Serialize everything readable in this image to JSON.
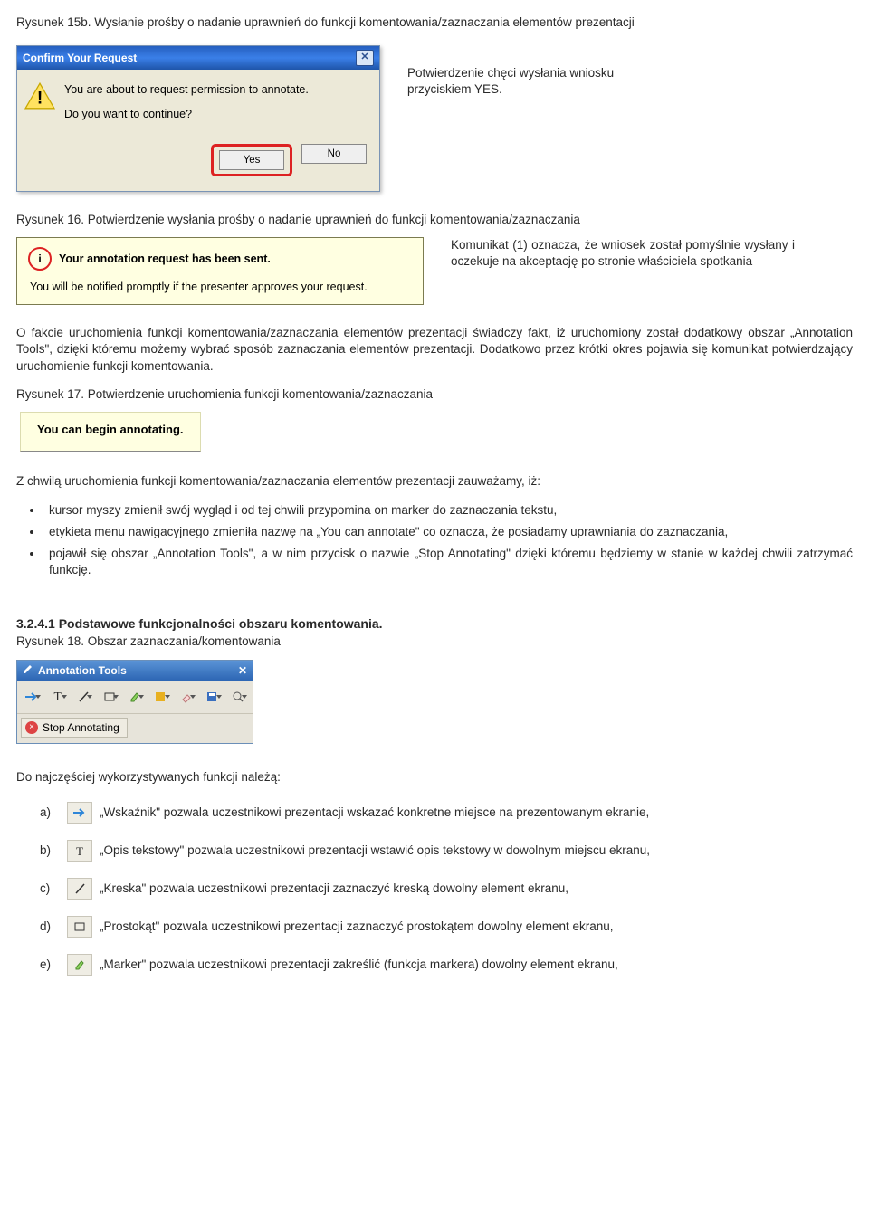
{
  "caption15b": "Rysunek 15b. Wysłanie prośby o nadanie uprawnień do funkcji komentowania/zaznaczania elementów prezentacji",
  "dlg1": {
    "title": "Confirm Your Request",
    "line1": "You are about to request permission to annotate.",
    "line2": "Do you want to continue?",
    "yes": "Yes",
    "no": "No",
    "close": "✕"
  },
  "aside1_l1": "Potwierdzenie chęci wysłania wniosku",
  "aside1_l2": "przyciskiem YES.",
  "caption16": "Rysunek 16. Potwierdzenie wysłania prośby o nadanie uprawnień do funkcji komentowania/zaznaczania",
  "info": {
    "badge": "i",
    "hdr": "Your annotation request has been sent.",
    "sub": "You will be notified promptly if the presenter approves your request."
  },
  "aside2": "Komunikat (1) oznacza, że wniosek został pomyślnie wysłany i oczekuje na akceptację po stronie właściciela spotkania",
  "para_fact": "O fakcie uruchomienia funkcji komentowania/zaznaczania elementów prezentacji świadczy fakt, iż uruchomiony został dodatkowy obszar „Annotation Tools\", dzięki któremu możemy wybrać sposób zaznaczania elementów  prezentacji. Dodatkowo przez krótki okres pojawia się komunikat potwierdzający uruchomienie funkcji komentowania.",
  "caption17": "Rysunek 17. Potwierdzenie uruchomienia funkcji komentowania/zaznaczania",
  "begin": "You can begin annotating.",
  "para_zchwil": "Z chwilą uruchomienia funkcji komentowania/zaznaczania elementów prezentacji zauważamy, iż:",
  "bul1": "kursor myszy zmienił swój wygląd i  od tej chwili przypomina on marker do zaznaczania tekstu,",
  "bul2": "etykieta menu nawigacyjnego zmieniła nazwę na „You can annotate\" co oznacza, że posiadamy uprawniania do zaznaczania,",
  "bul3": "pojawił się obszar „Annotation Tools\", a w nim przycisk o nazwie „Stop Annotating\" dzięki któremu będziemy w stanie w każdej chwili zatrzymać funkcję.",
  "section": "3.2.4.1 Podstawowe funkcjonalności obszaru komentowania.",
  "caption18": "Rysunek 18. Obszar zaznaczania/komentowania",
  "tools": {
    "title": "Annotation Tools",
    "close": "✕",
    "stop": "Stop Annotating"
  },
  "para_najcz": "Do najczęściej wykorzystywanych funkcji należą:",
  "fa": {
    "l": "a)",
    "t": "„Wskaźnik\" pozwala uczestnikowi prezentacji wskazać konkretne miejsce na prezentowanym ekranie,"
  },
  "fb": {
    "l": "b)",
    "t": "„Opis tekstowy\" pozwala uczestnikowi prezentacji wstawić opis tekstowy w dowolnym miejscu ekranu,"
  },
  "fc": {
    "l": "c)",
    "t": "„Kreska\" pozwala uczestnikowi prezentacji zaznaczyć kreską dowolny element ekranu,"
  },
  "fd": {
    "l": "d)",
    "t": "„Prostokąt\" pozwala uczestnikowi prezentacji zaznaczyć prostokątem dowolny element ekranu,"
  },
  "fe": {
    "l": "e)",
    "t": "„Marker\" pozwala uczestnikowi prezentacji zakreślić (funkcja markera) dowolny element ekranu,"
  }
}
